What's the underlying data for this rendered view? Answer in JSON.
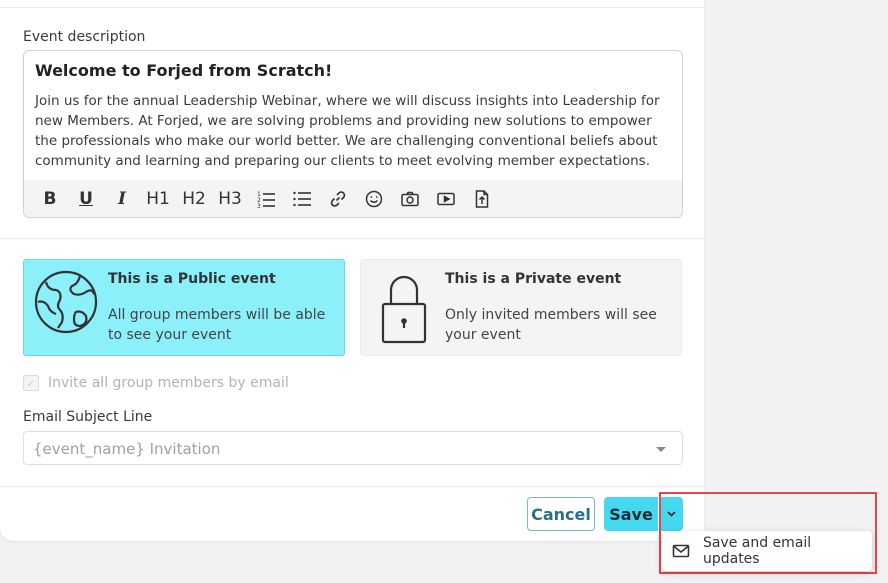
{
  "form": {
    "description_label": "Event description",
    "editor": {
      "heading": "Welcome to Forjed from Scratch!",
      "body": "Join us for the annual Leadership Webinar, where we will discuss insights into Leadership for new Members. At Forjed, we are solving problems and providing new solutions to empower the professionals who make our world better. We are challenging conventional beliefs about community and learning and preparing our clients to meet evolving member expectations.",
      "toolbar": {
        "bold": "B",
        "underline": "U",
        "italic": "I",
        "h1": "H1",
        "h2": "H2",
        "h3": "H3"
      }
    },
    "visibility": {
      "public": {
        "title": "This is a Public event",
        "description": "All group members will be able to see your event",
        "icon": "globe-icon",
        "selected": true
      },
      "private": {
        "title": "This is a Private event",
        "description": "Only invited members will see your event",
        "icon": "lock-icon",
        "selected": false
      }
    },
    "invite_checkbox_label": "Invite all group members by email",
    "email_subject": {
      "label": "Email Subject Line",
      "value": "{event_name} Invitation"
    }
  },
  "actions": {
    "cancel_label": "Cancel",
    "save_label": "Save",
    "dropdown_item": "Save and email updates"
  },
  "colors": {
    "accent": "#44d9f0",
    "public_card_bg": "#8cf0fb",
    "highlight": "#e84646"
  }
}
